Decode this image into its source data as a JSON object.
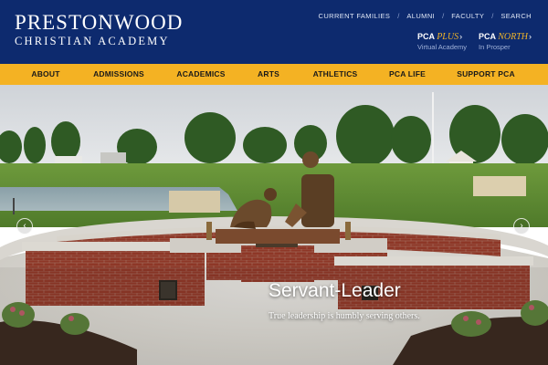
{
  "logo": {
    "line1": "PRESTONWOOD",
    "line2": "CHRISTIAN ACADEMY"
  },
  "utility_nav": [
    "CURRENT FAMILIES",
    "ALUMNI",
    "FACULTY",
    "SEARCH"
  ],
  "campuses": [
    {
      "prefix": "PCA",
      "accent": "PLUS",
      "sub": "Virtual Academy"
    },
    {
      "prefix": "PCA",
      "accent": "NORTH",
      "sub": "In Prosper"
    }
  ],
  "main_nav": [
    "ABOUT",
    "ADMISSIONS",
    "ACADEMICS",
    "ARTS",
    "ATHLETICS",
    "PCA LIFE",
    "SUPPORT PCA"
  ],
  "hero": {
    "title": "Servant-Leader",
    "subtitle": "True leadership is humbly serving others."
  },
  "colors": {
    "header_bg": "#0d2a6e",
    "nav_bg": "#f4b223",
    "accent": "#f0b428"
  },
  "icons": {
    "prev": "chevron-left-icon",
    "next": "chevron-right-icon"
  }
}
